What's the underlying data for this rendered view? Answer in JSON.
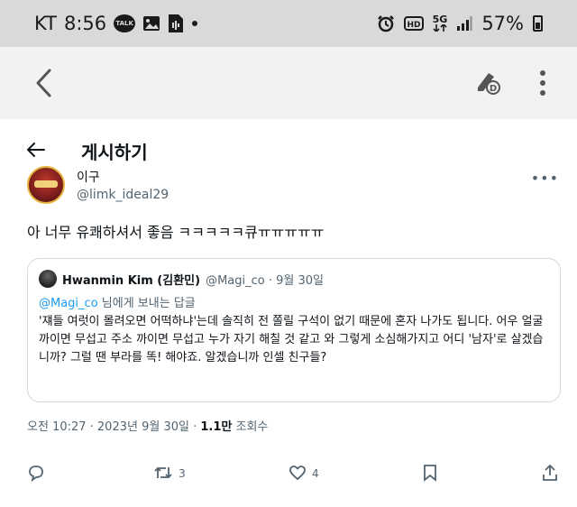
{
  "status_bar": {
    "carrier": "KT",
    "time": "8:56",
    "talk_badge": "TALK",
    "network": "5G",
    "battery": "57%"
  },
  "post_view": {
    "header_title": "게시하기"
  },
  "tweet": {
    "author_name": "이구",
    "author_handle": "@limk_ideal29",
    "text": "아 너무 유쾌하셔서 좋음 ㅋㅋㅋㅋㅋ큐ㅠㅠㅠㅠㅠ",
    "timestamp_prefix": "오전 10:27 · 2023년 9월 30일 ·",
    "views_count": "1.1만",
    "views_label": "조회수",
    "reply_count": "",
    "retweet_count": "3",
    "like_count": "4"
  },
  "quoted_tweet": {
    "author_name": "Hwanmin Kim (김환민)",
    "meta": "@Magi_co · 9월 30일",
    "reply_mention": "@Magi_co",
    "reply_suffix": "님에게 보내는 답글",
    "body": "'쟤들 여럿이 몰려오면 어떡하냐'는데 솔직히 전 쫄릴 구석이 없기 때문에 혼자 나가도 됩니다. 어우 얼굴 까이면 무섭고 주소 까이면 무섭고 누가 자기 해칠 것 같고 와 그렇게 소심해가지고 어디 '남자'로 살겠습니까? 그럴 땐 부라를 똑! 해야죠. 알겠습니까 인셀 친구들?"
  },
  "colors": {
    "status_bar_bg": "#d9d9d9",
    "app_bar_bg": "#f2f2f2",
    "link_blue": "#1d9bf0",
    "secondary_text": "#536471"
  },
  "icons": {
    "status_left": [
      "talk-icon",
      "image-icon",
      "audio-file-icon",
      "dot-icon"
    ],
    "status_right": [
      "alarm-icon",
      "hd-icon",
      "5g-icon",
      "signal-icon",
      "battery-icon"
    ],
    "app_bar": [
      "back-chevron-icon",
      "pen-download-icon",
      "kebab-menu-icon"
    ],
    "actions": [
      "reply-icon",
      "retweet-icon",
      "like-icon",
      "bookmark-icon",
      "share-icon"
    ]
  }
}
